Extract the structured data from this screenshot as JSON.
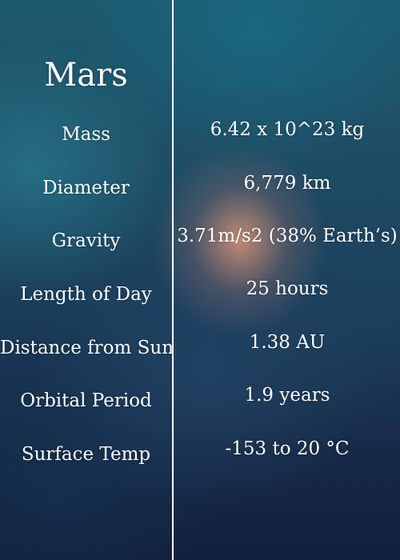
{
  "planet": {
    "name": "Mars"
  },
  "facts": [
    {
      "label": "Mass",
      "value": "6.42 x 10^23 kg"
    },
    {
      "label": "Diameter",
      "value": "6,779 km"
    },
    {
      "label": "Gravity",
      "value": "3.71m/s2 (38% Earth’s)"
    },
    {
      "label": "Length of Day",
      "value": "25 hours"
    },
    {
      "label": "Distance from Sun",
      "value": "1.38 AU"
    },
    {
      "label": "Orbital Period",
      "value": "1.9 years"
    },
    {
      "label": "Surface Temp",
      "value": "-153 to 20 °C"
    }
  ],
  "colors": {
    "text": "#ffffff",
    "divider": "#ffffff"
  }
}
